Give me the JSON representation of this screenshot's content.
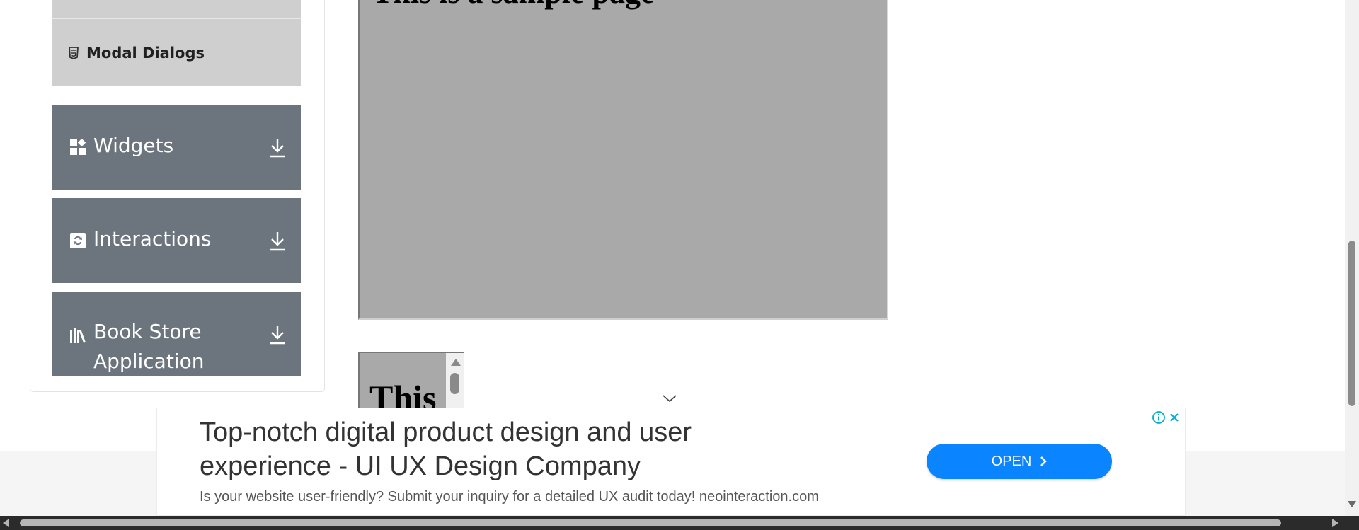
{
  "sidebar": {
    "active_item": {
      "label": "Modal Dialogs",
      "icon": "html5-icon"
    },
    "groups": [
      {
        "label": "Widgets",
        "icon": "widgets-icon",
        "toggle_icon": "download-arrow-icon"
      },
      {
        "label": "Interactions",
        "icon": "interactions-icon",
        "toggle_icon": "download-arrow-icon"
      },
      {
        "label": "Book Store Application",
        "icon": "library-books-icon",
        "toggle_icon": "download-arrow-icon"
      }
    ]
  },
  "frames": {
    "large_heading": "This is a sample page",
    "small_heading": "This"
  },
  "ad": {
    "headline": "Top-notch digital product design and user experience - UI UX Design Company",
    "description": "Is your website user-friendly? Submit your inquiry for a detailed UX audit today! neointeraction.com",
    "cta_label": "OPEN",
    "cta_color": "#0a84ff"
  },
  "colors": {
    "sidebar_group_bg": "#6c757d",
    "sidebar_active_bg": "#cfcfcf",
    "frame_bg": "#a9a9a9"
  }
}
